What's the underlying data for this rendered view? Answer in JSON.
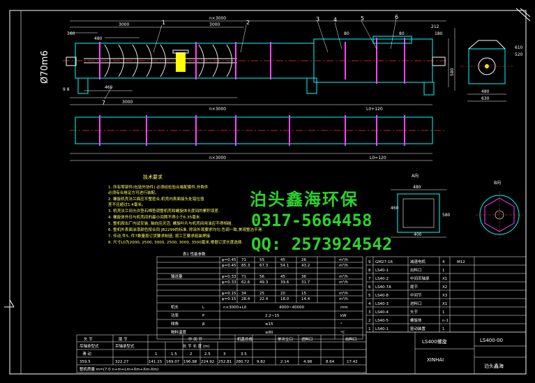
{
  "watermark": {
    "company": "泊头鑫海环保",
    "phone": "0317-5664458",
    "qq": "QQ: 2573924542"
  },
  "colors": {
    "background": "#000000",
    "frame": "#ffffff",
    "outline": "#00ffff",
    "dimension": "#ffffff",
    "centerline": "#ff3030",
    "flange": "#ff44ff",
    "screw": "#ffffff",
    "motor": "#ffff00",
    "notes": "#ffff66",
    "watermark": "#2ed12e"
  },
  "dimensions": {
    "top_overall": "n×3000",
    "seg_3000": "3000",
    "seg_3000b": "3000",
    "seg_480": "480",
    "seg_360": "360",
    "seg_80": "80",
    "seg_8080": "80",
    "seg_212": "212",
    "seg_180": "180",
    "diam": "Ø70m6",
    "left_98": "9 8",
    "left_460": "460",
    "bottom_3000": "3000",
    "bottom_n3000": "n×3000",
    "bottom_lr": "L0+120",
    "lower_n3000": "n×3000",
    "lower_lr": "L0=120",
    "side_480": "480",
    "side_580": "580",
    "side_630": "630",
    "side_610": "610",
    "side_520": "520",
    "section_a": "A向",
    "section_b": "B向",
    "a_480": "480",
    "a_400": "400",
    "a_460": "460",
    "a_580": "580"
  },
  "part_numbers": [
    "1",
    "2",
    "3",
    "4",
    "5",
    "6",
    "7"
  ],
  "notes": {
    "title": "技术要求",
    "lines": [
      "1. 所有零部件(包括外协件) 必须经检验合格配套件,外购件",
      "   必须有合格证方可进行装配。",
      "2. 螺旋机壳法兰面应平整密合,机壳内表面接头处错位值",
      "   差不应超过1.4毫米。",
      "3. 机壳法兰间允许垫石棉垫调整机壳和螺旋体长度间的累积误差.",
      "4. 螺旋体外径与机壳间的最小间隙不得小于6.35毫米.",
      "5. 整机按出厂内试安装, 轴向应灵活; 螺旋叶片与机壳间用油应不得相碰.",
      "6. 整机外表面涂漆颜色按合同 JB2299的标准, 除涂外观要求均匀,色调一致,美观整洁平滑.",
      "7. 传动,件5, 件7数量按订货要求制造, 按工艺要求组装焊接.",
      "8. 尺寸L0为2000, 2500, 3000, 2500, 3000, 3500毫米,根据订货长度选择."
    ]
  },
  "perf_table": {
    "title": "表1    性能参数",
    "rows": [
      {
        "label": "输送量",
        "rows": [
          [
            "φ=0.45",
            "71",
            "55",
            "45",
            "26"
          ],
          [
            "φ=0.45",
            "85.3",
            "67.3",
            "54.1",
            "43.2"
          ],
          [
            "φ=0.33",
            "71",
            "56",
            "45",
            "36"
          ],
          [
            "φ=0.33",
            "62.6",
            "49.3",
            "39.6",
            "31.7"
          ],
          [
            "φ=0.15",
            "34",
            "25",
            "20",
            "15"
          ],
          [
            "φ=0.15",
            "28.4",
            "22.4",
            "18.0",
            "14.4"
          ]
        ]
      },
      {
        "label": "机长",
        "rows": [
          [
            "L",
            "n×3000+L0",
            "4000~40000",
            "mm"
          ]
        ]
      },
      {
        "label": "功率",
        "rows": [
          [
            "P",
            "2.2~15",
            "kW"
          ]
        ]
      },
      {
        "label": "倾角",
        "rows": [
          [
            "β",
            "≤15",
            "°"
          ]
        ]
      },
      {
        "label": "物料温度",
        "rows": [
          [
            "",
            "≤80",
            "°C"
          ]
        ]
      }
    ],
    "units": [
      "m³/h",
      "m³/h",
      "m³/h",
      "m³/h",
      "m³/h",
      "m³/h",
      "mm",
      "kW",
      "°",
      "°C"
    ]
  },
  "parts_list": {
    "rows": [
      [
        "9",
        "GM27-16",
        "减速电机",
        "4",
        "M12"
      ],
      [
        "8",
        "LS40-1",
        "出料口",
        "1",
        ""
      ],
      [
        "7",
        "LS40-2",
        "中间吊轴承",
        "X1",
        ""
      ],
      [
        "6",
        "LS40-7A",
        "尾节",
        "X2",
        ""
      ],
      [
        "5",
        "LS40-8",
        "中间节",
        "X3",
        ""
      ],
      [
        "4",
        "LS40-3",
        "进料口",
        "X1",
        ""
      ],
      [
        "3",
        "LS40-4",
        "头节",
        "1",
        ""
      ],
      [
        "2",
        "LS40-5",
        "螺旋体",
        "n-1",
        ""
      ],
      [
        "1",
        "LS40-1",
        "驱动装置",
        "1",
        ""
      ]
    ]
  },
  "bottom_table": {
    "header": [
      "头 节",
      "尾 节",
      "中 间 节",
      "机盖总成",
      "单次立口",
      "进料口",
      "出料口"
    ],
    "row2": [
      "吊轴承型式",
      "吊轴承型式",
      "",
      "长 节 长 度 (m)",
      "",
      "",
      ""
    ],
    "row3": [
      "滑 动",
      "",
      "1",
      "1.5",
      "2",
      "2.5",
      "3",
      "3.5",
      ""
    ],
    "row4": [
      "359.5",
      "322.27",
      "141.15",
      "169.07",
      "196.98",
      "224.92",
      "252.81",
      "280.72",
      "9.82",
      "2.14",
      "4.98",
      "8.64",
      "17.42"
    ],
    "row5": "整机质量      m=(7.0 n+m+Lm+Xm+Xm-Xm)"
  },
  "title_block": {
    "name1": "LS400螺旋",
    "name2": "XINHAI",
    "drawing_no": "LS400-00",
    "company": "泊头鑫海"
  }
}
